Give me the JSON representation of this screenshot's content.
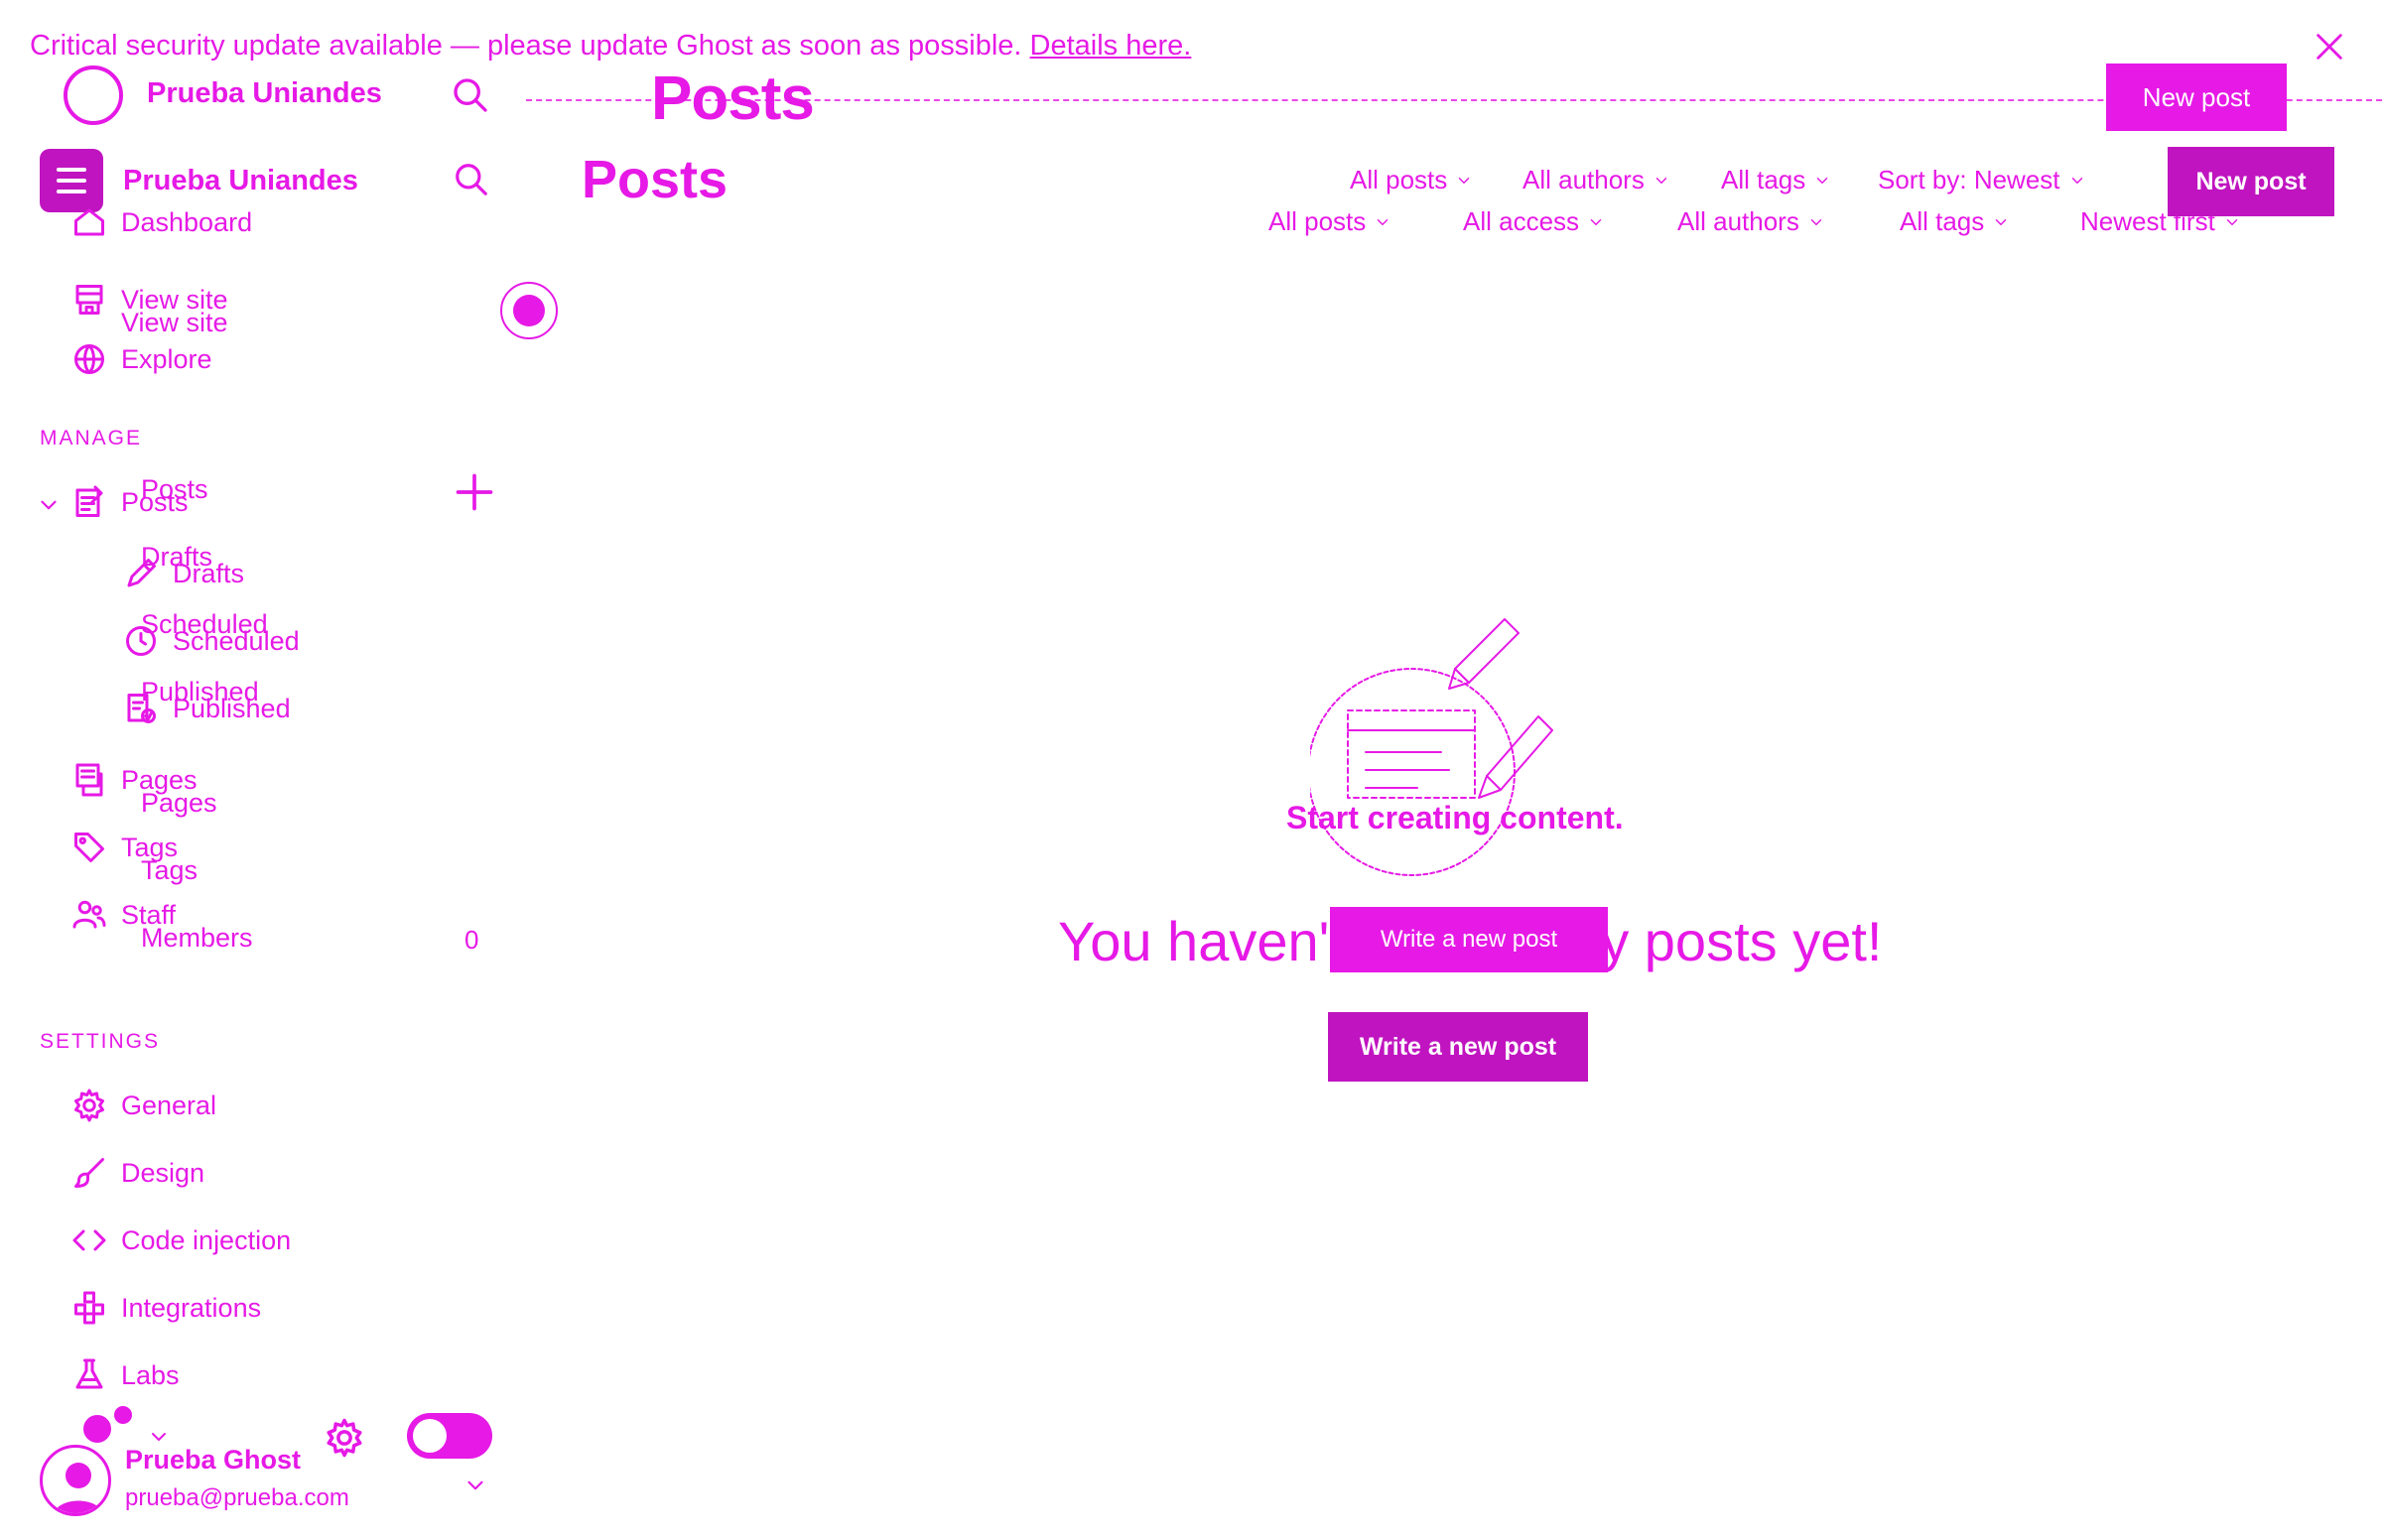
{
  "banner": {
    "message": "Critical security update available — please update Ghost as soon as possible.",
    "link": "Details here."
  },
  "site": {
    "name": "Prueba Uniandes"
  },
  "ghost_header": {
    "title": "Posts",
    "new_post": "New post"
  },
  "sidebar": {
    "top_items": [
      {
        "label": "Dashboard",
        "icon": "home-icon"
      },
      {
        "label": "View site",
        "icon": "storefront-icon"
      },
      {
        "label": "Explore",
        "icon": "globe-icon"
      }
    ],
    "ghost_view_site": "View site",
    "manage_label": "MANAGE",
    "posts": {
      "label": "Posts",
      "ghost_label": "Posts"
    },
    "post_subitems": [
      {
        "label": "Drafts",
        "ghost_label": "Drafts",
        "icon": "pencil-icon"
      },
      {
        "label": "Scheduled",
        "ghost_label": "Scheduled",
        "icon": "clock-icon"
      },
      {
        "label": "Published",
        "ghost_label": "Published",
        "icon": "published-icon"
      }
    ],
    "pages": {
      "label": "Pages",
      "ghost_label": "Pages"
    },
    "tags": {
      "label": "Tags",
      "ghost_label": "Tags"
    },
    "members": {
      "label": "Staff",
      "ghost_label": "Members",
      "count": "0"
    },
    "settings_label": "SETTINGS",
    "settings_items": [
      {
        "label": "General",
        "icon": "gear-icon"
      },
      {
        "label": "Design",
        "icon": "brush-icon"
      },
      {
        "label": "Code injection",
        "icon": "code-icon"
      },
      {
        "label": "Integrations",
        "icon": "integrations-icon"
      },
      {
        "label": "Labs",
        "icon": "flask-icon"
      }
    ]
  },
  "user": {
    "name": "Prueba Ghost",
    "email": "prueba@prueba.com"
  },
  "main": {
    "title": "Posts",
    "filters_row1": [
      "All posts",
      "All authors",
      "All tags",
      "Sort by: Newest"
    ],
    "filters_row2": [
      "All posts",
      "All access",
      "All authors",
      "All tags",
      "Newest first"
    ],
    "new_post": "New post",
    "empty_ghost": "Start creating content.",
    "empty_message": "You haven't written any posts yet!",
    "ghost_write": "Write a new post",
    "write_button": "Write a new post"
  },
  "colors": {
    "accent": "#e619e6",
    "accent_dark": "#c014c0",
    "background": "#ffffff"
  }
}
